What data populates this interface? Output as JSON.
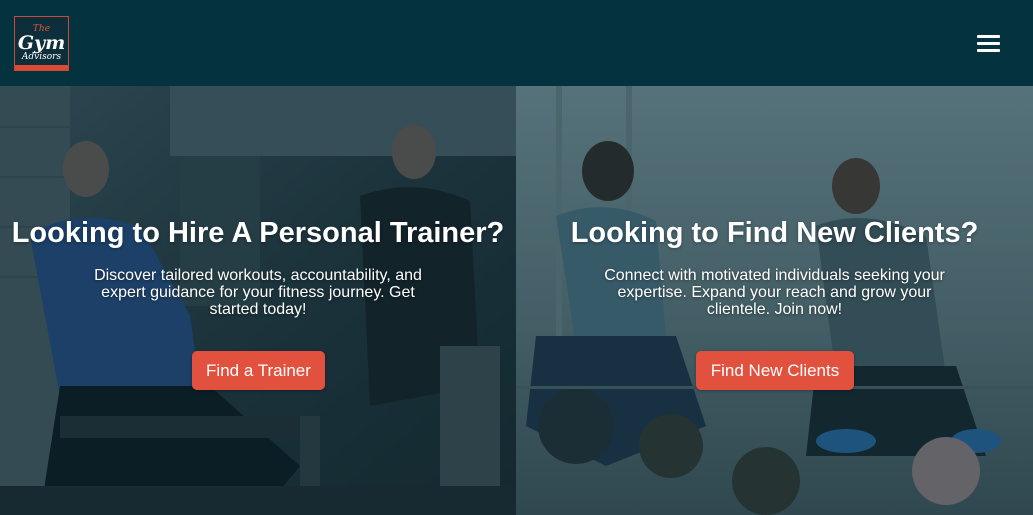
{
  "header": {
    "logo": {
      "line1": "The",
      "line2": "Gym",
      "line3": "Advisors"
    },
    "menu_icon": "hamburger-menu-icon"
  },
  "panels": [
    {
      "heading": "Looking to Hire A Personal Trainer?",
      "description": "Discover tailored workouts, accountability, and expert guidance for your fitness journey. Get started today!",
      "button_label": "Find a Trainer"
    },
    {
      "heading": "Looking to Find New Clients?",
      "description": "Connect with motivated individuals seeking your expertise. Expand your reach and grow your clientele. Join now!",
      "button_label": "Find New Clients"
    }
  ],
  "colors": {
    "nav_background": "#05323f",
    "accent": "#e2513e",
    "overlay": "#062d3a"
  }
}
